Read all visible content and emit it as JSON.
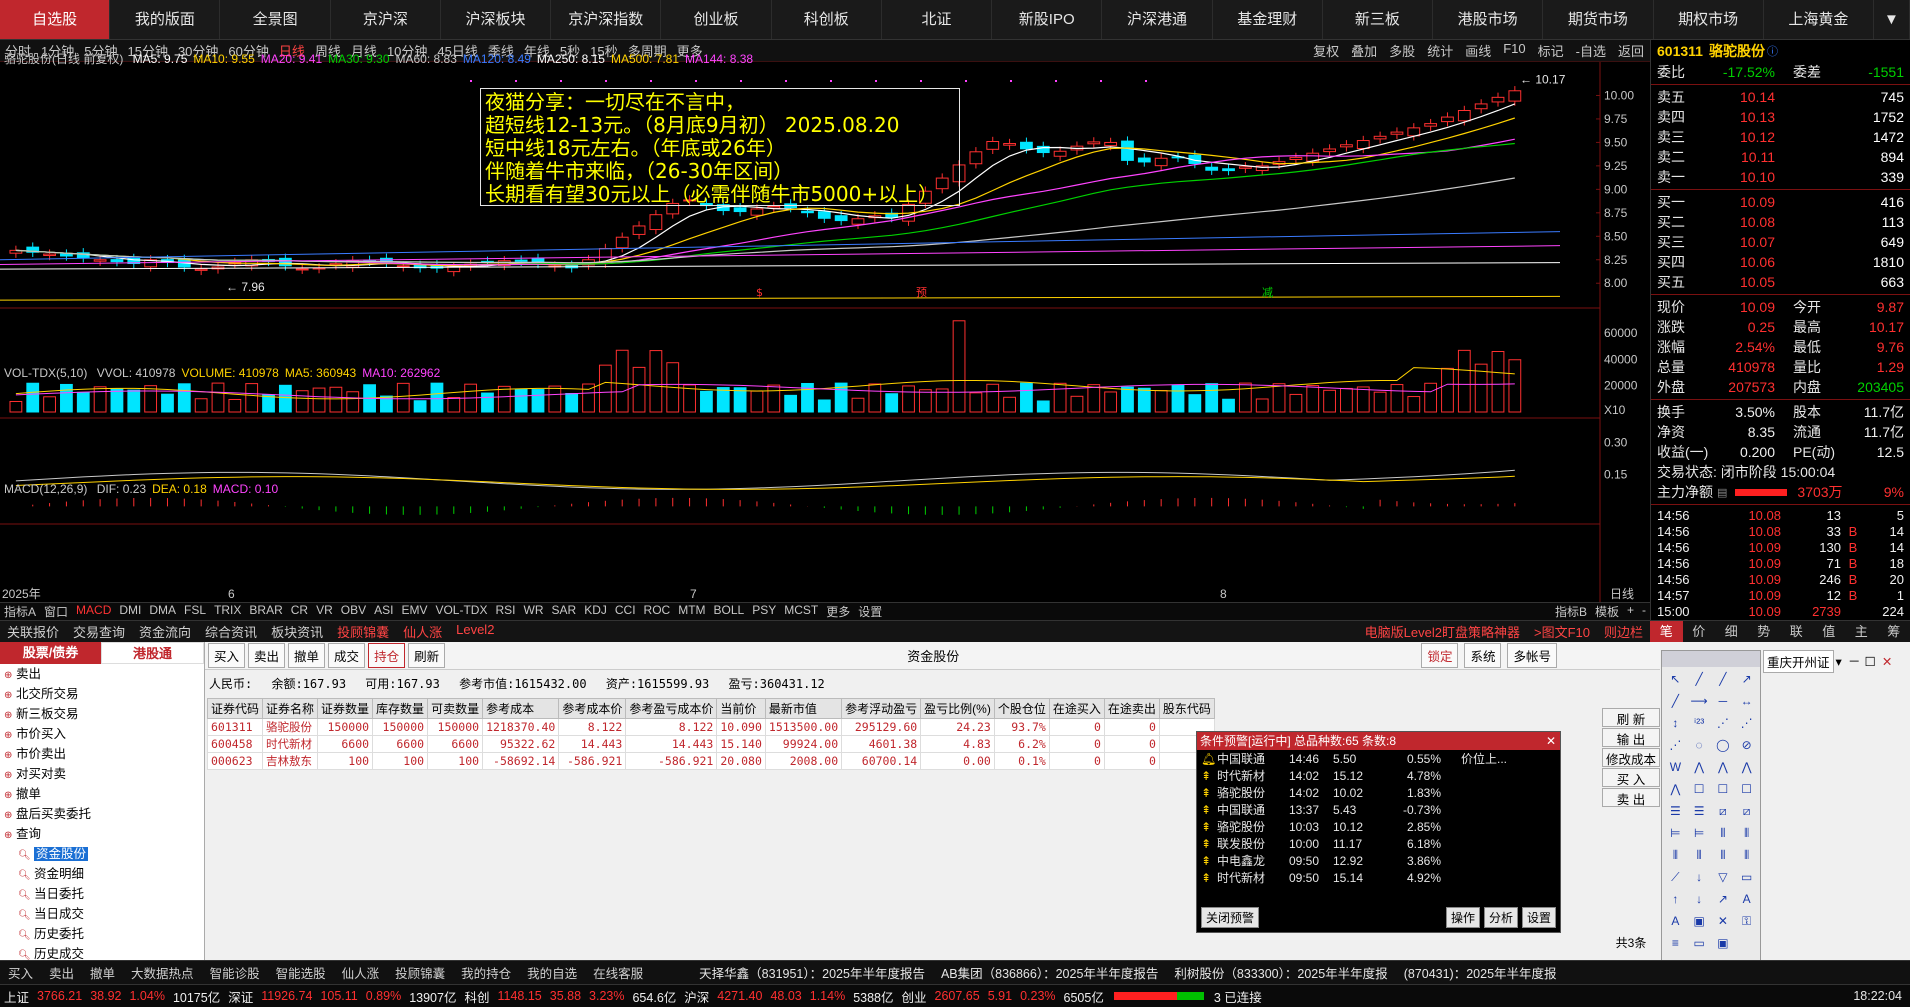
{
  "topnav": [
    "自选股",
    "我的版面",
    "全景图",
    "京沪深",
    "沪深板块",
    "京沪深指数",
    "创业板",
    "科创板",
    "北证",
    "新股IPO",
    "沪深港通",
    "基金理财",
    "新三板",
    "港股市场",
    "期货市场",
    "期权市场",
    "上海黄金"
  ],
  "periods": [
    "分时",
    "1分钟",
    "5分钟",
    "15分钟",
    "30分钟",
    "60分钟",
    "日线",
    "周线",
    "月线",
    "10分钟",
    "45日线",
    "季线",
    "年线",
    "5秒",
    "15秒",
    "多周期",
    "更多"
  ],
  "period_tools": [
    "复权",
    "叠加",
    "多股",
    "统计",
    "画线",
    "F10",
    "标记",
    "-自选",
    "返回"
  ],
  "chart": {
    "title": "骆驼股份(日线 前复权)",
    "ma": [
      {
        "label": "MA5: 9.75",
        "color": "#ffffff"
      },
      {
        "label": "MA10: 9.55",
        "color": "#ffd200"
      },
      {
        "label": "MA20: 9.41",
        "color": "#ff44ff"
      },
      {
        "label": "MA30: 9.30",
        "color": "#00d000"
      },
      {
        "label": "MA60: 8.83",
        "color": "#c8c8c8"
      },
      {
        "label": "MA120: 8.49",
        "color": "#3a7bff"
      },
      {
        "label": "MA250: 8.15",
        "color": "#ffffff"
      },
      {
        "label": "MA500: 7.81",
        "color": "#ffd200"
      },
      {
        "label": "MA144: 8.38",
        "color": "#ff44ff"
      }
    ],
    "price_ticks": [
      "10.00",
      "9.75",
      "9.50",
      "9.25",
      "9.00",
      "8.75",
      "8.50",
      "8.25",
      "8.00"
    ],
    "high_label": "10.17",
    "low_label": "7.96",
    "vol_title": "VOL-TDX(5,10)",
    "vol_legend": [
      {
        "label": "VVOL: 410978",
        "color": "#c8c8c8"
      },
      {
        "label": "VOLUME: 410978",
        "color": "#ffd200"
      },
      {
        "label": "MA5: 360943",
        "color": "#ffd200"
      },
      {
        "label": "MA10: 262962",
        "color": "#ff44ff"
      }
    ],
    "vol_ticks": [
      "60000",
      "40000",
      "20000"
    ],
    "vol_unit": "X10",
    "macd_title": "MACD(12,26,9)",
    "macd_legend": [
      {
        "label": "DIF: 0.23",
        "color": "#c8c8c8"
      },
      {
        "label": "DEA: 0.18",
        "color": "#ffd200"
      },
      {
        "label": "MACD: 0.10",
        "color": "#ff44ff"
      }
    ],
    "macd_ticks": [
      "0.30",
      "0.15"
    ],
    "x_labels": [
      "2025年",
      "6",
      "7",
      "8"
    ],
    "period_label": "日线",
    "markers": [
      "$",
      "预",
      "减"
    ]
  },
  "annotation": [
    "夜猫分享：一切尽在不言中，",
    "超短线12-13元。（8月底9月初）      2025.08.20",
    "短中线18元左右。（年底或26年）",
    "伴随着牛市来临，（26-30年区间）",
    "长期看有望30元以上（必需伴随牛市5000+以上）"
  ],
  "indicators": [
    "指标A",
    "窗口",
    "MACD",
    "DMI",
    "DMA",
    "FSL",
    "TRIX",
    "BRAR",
    "CR",
    "VR",
    "OBV",
    "ASI",
    "EMV",
    "VOL-TDX",
    "RSI",
    "WR",
    "SAR",
    "KDJ",
    "CCI",
    "ROC",
    "MTM",
    "BOLL",
    "PSY",
    "MCST",
    "更多",
    "设置"
  ],
  "indicators_right": [
    "指标B",
    "模板",
    "+",
    "-"
  ],
  "quote": {
    "code": "601311",
    "name": "骆驼股份",
    "webi": "-17.52%",
    "weicha": "-1551",
    "asks": [
      {
        "label": "卖五",
        "price": "10.14",
        "vol": "745"
      },
      {
        "label": "卖四",
        "price": "10.13",
        "vol": "1752"
      },
      {
        "label": "卖三",
        "price": "10.12",
        "vol": "1472"
      },
      {
        "label": "卖二",
        "price": "10.11",
        "vol": "894"
      },
      {
        "label": "卖一",
        "price": "10.10",
        "vol": "339"
      }
    ],
    "bids": [
      {
        "label": "买一",
        "price": "10.09",
        "vol": "416"
      },
      {
        "label": "买二",
        "price": "10.08",
        "vol": "113"
      },
      {
        "label": "买三",
        "price": "10.07",
        "vol": "649"
      },
      {
        "label": "买四",
        "price": "10.06",
        "vol": "1810"
      },
      {
        "label": "买五",
        "price": "10.05",
        "vol": "663"
      }
    ],
    "stats": [
      [
        "现价",
        "10.09",
        "今开",
        "9.87"
      ],
      [
        "涨跌",
        "0.25",
        "最高",
        "10.17"
      ],
      [
        "涨幅",
        "2.54%",
        "最低",
        "9.76"
      ],
      [
        "总量",
        "410978",
        "量比",
        "1.29"
      ],
      [
        "外盘",
        "207573",
        "内盘",
        "203405"
      ]
    ],
    "stats2": [
      [
        "换手",
        "3.50%",
        "股本",
        "11.7亿"
      ],
      [
        "净资",
        "8.35",
        "流通",
        "11.7亿"
      ],
      [
        "收益(一)",
        "0.200",
        "PE(动)",
        "12.5"
      ]
    ],
    "trade_state": "交易状态: 闭市阶段 15:00:04",
    "main_net_label": "主力净额",
    "main_net": "3703万",
    "main_net_pct": "9%",
    "ticks": [
      [
        "14:56",
        "10.08",
        "13",
        "",
        "5"
      ],
      [
        "14:56",
        "10.08",
        "33",
        "B",
        "14"
      ],
      [
        "14:56",
        "10.09",
        "130",
        "B",
        "14"
      ],
      [
        "14:56",
        "10.09",
        "71",
        "B",
        "18"
      ],
      [
        "14:56",
        "10.09",
        "246",
        "B",
        "20"
      ],
      [
        "14:57",
        "10.09",
        "12",
        "B",
        "1"
      ],
      [
        "15:00",
        "10.09",
        "2739",
        "",
        "224"
      ]
    ]
  },
  "qtabs": [
    "笔",
    "价",
    "细",
    "势",
    "联",
    "值",
    "主",
    "筹"
  ],
  "tradebar": [
    "关联报价",
    "交易查询",
    "资金流向",
    "综合资讯",
    "板块资讯",
    "投顾锦囊",
    "仙人涨",
    "Level2"
  ],
  "tradebar_right": [
    "电脑版Level2盯盘策略神器",
    ">图文F10",
    "则边栏"
  ],
  "tree": {
    "tab1": "股票/债券",
    "tab2": "港股通",
    "items": [
      "卖出",
      "北交所交易",
      "新三板交易",
      "市价买入",
      "市价卖出",
      "对买对卖",
      "撤单",
      "盘后买卖委托",
      "查询"
    ],
    "subitems": [
      "资金股份",
      "资金明细",
      "当日委托",
      "当日成交",
      "历史委托",
      "历史成交"
    ]
  },
  "tbtns": [
    "买入",
    "卖出",
    "撤单",
    "成交",
    "持仓",
    "刷新"
  ],
  "tbtns_title": "资金股份",
  "tbtns_right": [
    "锁定",
    "系统",
    "多帐号"
  ],
  "account": {
    "currency": "人民币:",
    "balance": "余额:167.93",
    "available": "可用:167.93",
    "refvalue": "参考市值:1615432.00",
    "assets": "资产:1615599.93",
    "pnl": "盈亏:360431.12"
  },
  "holdings_cols": [
    "证券代码",
    "证券名称",
    "证券数量",
    "库存数量",
    "可卖数量",
    "参考成本",
    "参考成本价",
    "参考盈亏成本价",
    "当前价",
    "最新市值",
    "参考浮动盈亏",
    "盈亏比例(%)",
    "个股仓位",
    "在途买入",
    "在途卖出",
    "股东代码"
  ],
  "holdings": [
    [
      "601311",
      "骆驼股份",
      "150000",
      "150000",
      "150000",
      "1218370.40",
      "8.122",
      "8.122",
      "10.090",
      "1513500.00",
      "295129.60",
      "24.23",
      "93.7%",
      "0",
      "0",
      ""
    ],
    [
      "600458",
      "时代新材",
      "6600",
      "6600",
      "6600",
      "95322.62",
      "14.443",
      "14.443",
      "15.140",
      "99924.00",
      "4601.38",
      "4.83",
      "6.2%",
      "0",
      "0",
      ""
    ],
    [
      "000623",
      "吉林敖东",
      "100",
      "100",
      "100",
      "-58692.14",
      "-586.921",
      "-586.921",
      "20.080",
      "2008.00",
      "60700.14",
      "0.00",
      "0.1%",
      "0",
      "0",
      ""
    ]
  ],
  "sidebtns": [
    "刷 新",
    "输 出",
    "修改成本",
    "买 入",
    "卖 出"
  ],
  "count_label": "共3条",
  "alert": {
    "title": "条件预警[运行中] 总品种数:65 条数:8",
    "rows": [
      [
        "中国联通",
        "14:46",
        "5.50",
        "0.55%",
        "价位上..."
      ],
      [
        "时代新材",
        "14:02",
        "15.12",
        "4.78%",
        ""
      ],
      [
        "骆驼股份",
        "14:02",
        "10.02",
        "1.83%",
        ""
      ],
      [
        "中国联通",
        "13:37",
        "5.43",
        "-0.73%",
        ""
      ],
      [
        "骆驼股份",
        "10:03",
        "10.12",
        "2.85%",
        ""
      ],
      [
        "联发股份",
        "10:00",
        "11.17",
        "6.18%",
        ""
      ],
      [
        "中电鑫龙",
        "09:50",
        "12.92",
        "3.86%",
        ""
      ],
      [
        "时代新材",
        "09:50",
        "15.14",
        "4.92%",
        ""
      ]
    ],
    "close": "关闭预警",
    "ops": [
      "操作",
      "分析",
      "设置"
    ]
  },
  "thirdsel": "重庆开州证",
  "toolbar": [
    "买入",
    "卖出",
    "撤单",
    "大数据热点",
    "智能诊股",
    "智能选股",
    "仙人涨",
    "投顾锦囊",
    "我的持仓",
    "我的自选",
    "在线客服"
  ],
  "news": [
    "天择华鑫（831951）：2025年半年度报告",
    "AB集团（836866）：2025年半年度报告",
    "利树股份（833300）：2025年半年度报",
    "(870431)：2025年半年度报"
  ],
  "status": {
    "sh": "上证",
    "sh_val": "3766.21",
    "sh_chg": "38.92",
    "sh_pct": "1.04%",
    "sh_amt": "10175亿",
    "sz": "深证",
    "sz_val": "11926.74",
    "sz_chg": "105.11",
    "sz_pct": "0.89%",
    "sz_amt": "13907亿",
    "kc": "科创",
    "kc_val": "1148.15",
    "kc_chg": "35.88",
    "kc_pct": "3.23%",
    "kc_amt": "654.6亿",
    "hs": "沪深",
    "hs_val": "4271.40",
    "hs_chg": "48.03",
    "hs_pct": "1.14%",
    "hs_amt": "5388亿",
    "cy": "创业",
    "cy_val": "2607.65",
    "cy_chg": "5.91",
    "cy_pct": "0.23%",
    "cy_amt": "6505亿",
    "conn": "3 已连接",
    "time": "18:22:04"
  }
}
